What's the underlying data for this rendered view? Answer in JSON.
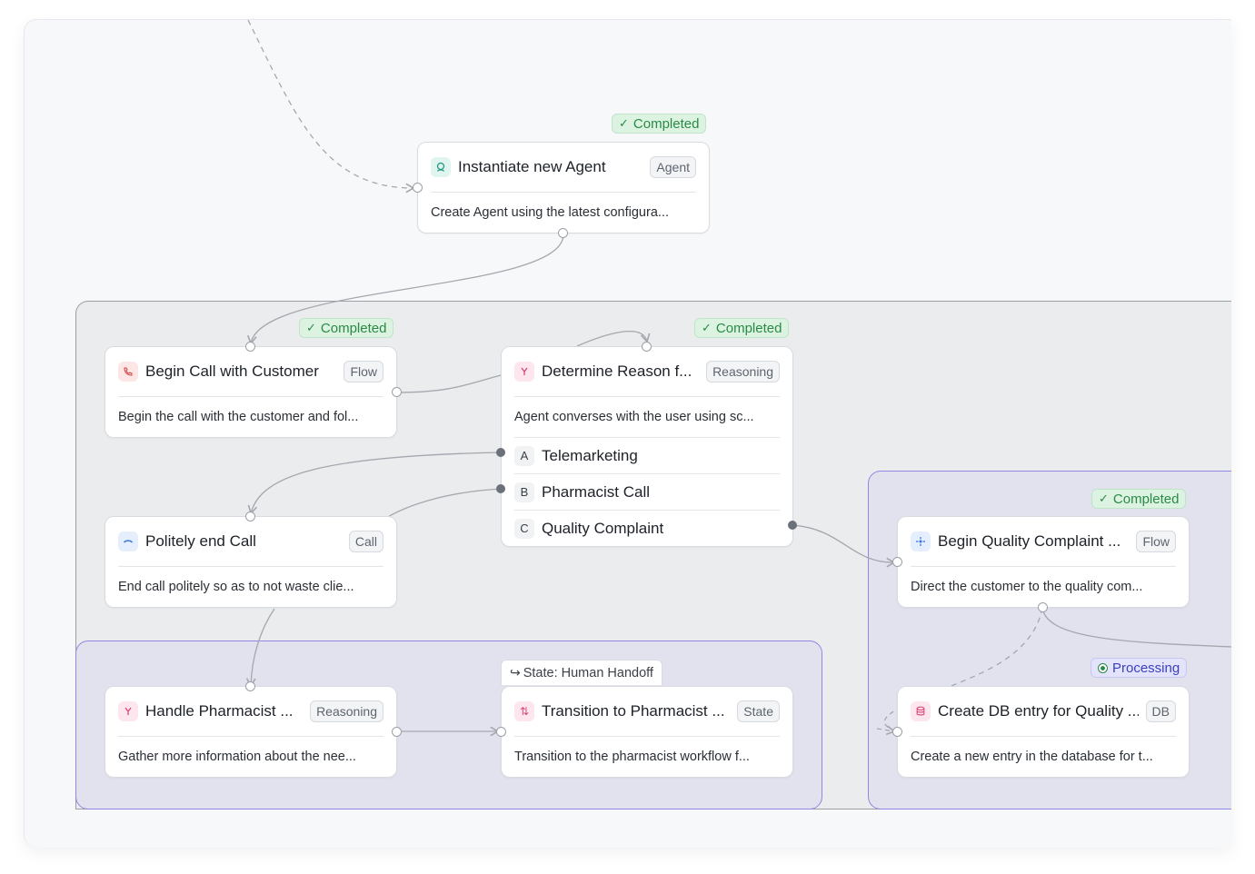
{
  "colors": {
    "completed": "#2a8a45",
    "processing": "#3a3fc0",
    "group_border": "#8f87e6",
    "edge": "#a4a8ae"
  },
  "nodes": {
    "instantiate_agent": {
      "status": "Completed",
      "title": "Instantiate new Agent",
      "badge": "Agent",
      "icon": "agent-icon",
      "description": "Create Agent using the latest configura..."
    },
    "begin_call": {
      "status": "Completed",
      "title": "Begin Call with Customer",
      "badge": "Flow",
      "icon": "phone-incoming-icon",
      "description": "Begin the call with the customer and fol..."
    },
    "determine_reason": {
      "status": "Completed",
      "title": "Determine Reason f...",
      "badge": "Reasoning",
      "icon": "branch-icon",
      "description": "Agent converses with the user using sc...",
      "options": [
        {
          "letter": "A",
          "label": "Telemarketing"
        },
        {
          "letter": "B",
          "label": "Pharmacist Call"
        },
        {
          "letter": "C",
          "label": "Quality Complaint"
        }
      ]
    },
    "politely_end": {
      "title": "Politely end Call",
      "badge": "Call",
      "icon": "hangup-icon",
      "description": "End call politely so as to not waste clie..."
    },
    "handle_pharmacist": {
      "title": "Handle Pharmacist ...",
      "badge": "Reasoning",
      "icon": "branch-icon",
      "description": "Gather more information about the nee..."
    },
    "transition_pharmacist": {
      "state_label": "State: Human Handoff",
      "title": "Transition to Pharmacist ...",
      "badge": "State",
      "icon": "state-arrows-icon",
      "description": "Transition to the pharmacist workflow f..."
    },
    "begin_quality": {
      "status": "Completed",
      "title": "Begin Quality Complaint ...",
      "badge": "Flow",
      "icon": "flow-icon",
      "description": "Direct the customer to the quality com..."
    },
    "create_db": {
      "status": "Processing",
      "title": "Create DB entry for Quality ...",
      "badge": "DB",
      "icon": "database-icon",
      "description": "Create a new entry in the database for t..."
    }
  }
}
